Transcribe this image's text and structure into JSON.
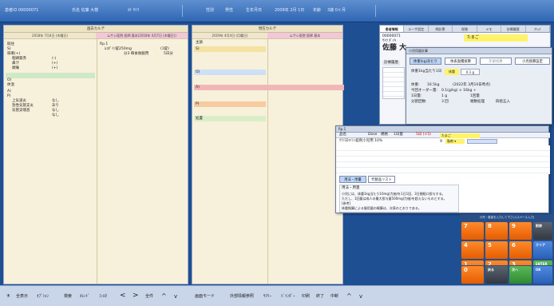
{
  "topbar": {
    "fields": [
      "患者ID 00000071",
      "氏名 佐藤 大樹",
      "ｶﾅ ｻﾄｳ",
      "性別",
      "男性",
      "生年月日",
      "2009年 2月 1日",
      "年齢",
      "3歳 0ヶ月"
    ]
  },
  "left_panel": {
    "title": "過去カルテ",
    "col1": "2018年 7月4日 (木曜日)",
    "col2": "ムサシ医院 医師 基本(2018年 4月7日 (木曜日))",
    "left_rows": [
      "既往",
      "S)",
      "咳嗽(+)",
      "咽頭発赤",
      "鼻汁",
      "頭痛",
      "O)",
      "体温",
      "A)",
      "P)",
      "上気道炎",
      "急性気管支炎",
      "気管支喘息"
    ],
    "values": [
      "(-)",
      "(+)",
      "(+)",
      "なし",
      "あり",
      "なし",
      "なし"
    ],
    "rx": [
      "Rp.1",
      "ﾑｺﾀﾞｲﾝ錠250mg",
      "分3 毎食後服用",
      "(1錠)",
      "5日分"
    ]
  },
  "middle_panel": {
    "title": "現在カルテ",
    "col1": "2019年 4月4日 (月曜日)",
    "col2": "ムサシ医院 医師 基本",
    "sections": [
      "主訴",
      "S)",
      "O)",
      "A)",
      "P)",
      "処置"
    ]
  },
  "right_panel": {
    "tabs": [
      "患者情報",
      "ユーザ設定",
      "問診票",
      "保険",
      "メモ",
      "診療履歴",
      "ｸﾘｯｸ"
    ],
    "patient_id": "00000071",
    "kana": "ｻﾄｳ ﾀﾞｲｷ",
    "name": "佐藤 大",
    "allergy": "たまご",
    "history_label": "診療履歴"
  },
  "dose_dialog": {
    "title": "小児用量計算",
    "tabs": [
      "体重(kg)あたり",
      "体表面積換算",
      "年齢換算",
      "小児換算設定"
    ],
    "row1_label": "体重1kg当たり1日",
    "row1_unit": "体重",
    "row1_value": "0.1 g",
    "weight_label": "体重:",
    "weight_value": "16.5kg",
    "weight_date": "(2022年 3月10日時点)",
    "today_label": "今回オーダー量:",
    "today_value": "0.1(g/kg) × 16kg ÷",
    "day_label": "1日量:",
    "day_value": "1 g",
    "day_unit": "1回量",
    "times_label": "分割回数:",
    "times_value": "3 回",
    "round_label": "端数処理",
    "round_value": "四捨五入"
  },
  "rx_dialog": {
    "title": "Rp.1",
    "headers": [
      "品名",
      "Dose",
      "規格",
      "1日量",
      "5日 (×5)"
    ],
    "drug": "ｸﾗﾘｽﾛﾏｲｼﾝ錠剤小児用 10%",
    "allergy_tag": "たまご",
    "unit": "g",
    "select": "製剤 ▾",
    "tab1": "用法・用量",
    "tab2": "代替品リスト",
    "usage_title": "用法・用量",
    "usage_lines": [
      "小児には、体重1kg当たり10mg(力価)を1日1回、3日間経口投与する。",
      "ただし、1回量は成人の最大投与量500mg(力価)を超えないものとする。",
      "[参考]",
      "体重換算による服用量の概算は、次表のとおりである。"
    ]
  },
  "keypad": {
    "header": "小児・患者を入力して下さい(スペース入力)",
    "keys": [
      "7",
      "8",
      "9",
      "4",
      "5",
      "6",
      "1",
      "2",
      "3",
      "0"
    ],
    "side": [
      "削除",
      "クリア",
      "ENTER",
      "戻る",
      "次へ",
      "OK"
    ]
  },
  "bottombar": {
    "left": [
      "全表示",
      "ｵﾌﾟｼｮﾝ",
      "検索",
      "ｶﾚﾝﾄﾞ",
      "ﾌｨﾙﾀ",
      "<",
      ">",
      "全件",
      "^",
      "v"
    ],
    "middle": [
      "画面モード",
      "外部情報参照",
      "ｻﾏﾘｰ",
      "ﾊﾞｲﾝﾀﾞｰ",
      "印刷",
      "終了",
      "中断",
      "^",
      "v"
    ]
  },
  "colors": {
    "accent_blue": "#2f66b3",
    "orange_key": "#ff8a2a",
    "pink": "#f2c7d8",
    "yellow": "#fff36b"
  }
}
